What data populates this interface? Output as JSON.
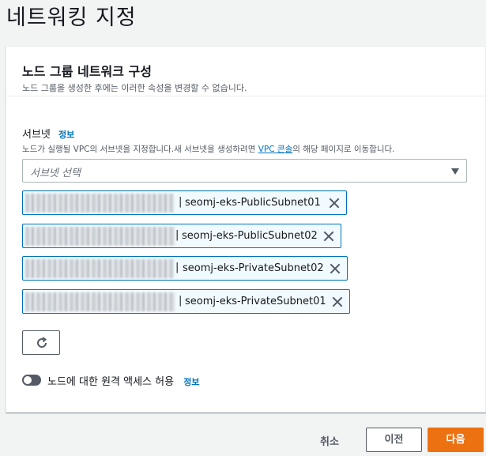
{
  "page": {
    "title": "네트워킹 지정"
  },
  "panel": {
    "title": "노드 그룹 네트워크 구성",
    "description": "노드 그룹을 생성한 후에는 이러한 속성을 변경할 수 없습니다."
  },
  "subnets": {
    "label": "서브넷",
    "info": "정보",
    "desc_before": "노드가 실행될 VPC의 서브넷을 지정합니다.새 서브넷을 생성하려면 ",
    "desc_link": "VPC 콘솔",
    "desc_after": "의 해당 페이지로 이동합니다.",
    "select_placeholder": "서브넷 선택",
    "selected": [
      {
        "name": "seomj-eks-PublicSubnet01"
      },
      {
        "name": "seomj-eks-PublicSubnet02"
      },
      {
        "name": "seomj-eks-PrivateSubnet02"
      },
      {
        "name": "seomj-eks-PrivateSubnet01"
      }
    ],
    "separator": "|"
  },
  "remote_access": {
    "label": "노드에 대한 원격 액세스 허용",
    "info": "정보",
    "enabled": false
  },
  "footer": {
    "cancel": "취소",
    "previous": "이전",
    "next": "다음"
  },
  "colors": {
    "accent": "#ec7211",
    "link": "#0073bb",
    "token_border": "#0073bb",
    "token_bg": "#f1faff"
  },
  "icons": {
    "dropdown": "caret-down-icon",
    "remove": "close-icon",
    "refresh": "refresh-icon"
  }
}
